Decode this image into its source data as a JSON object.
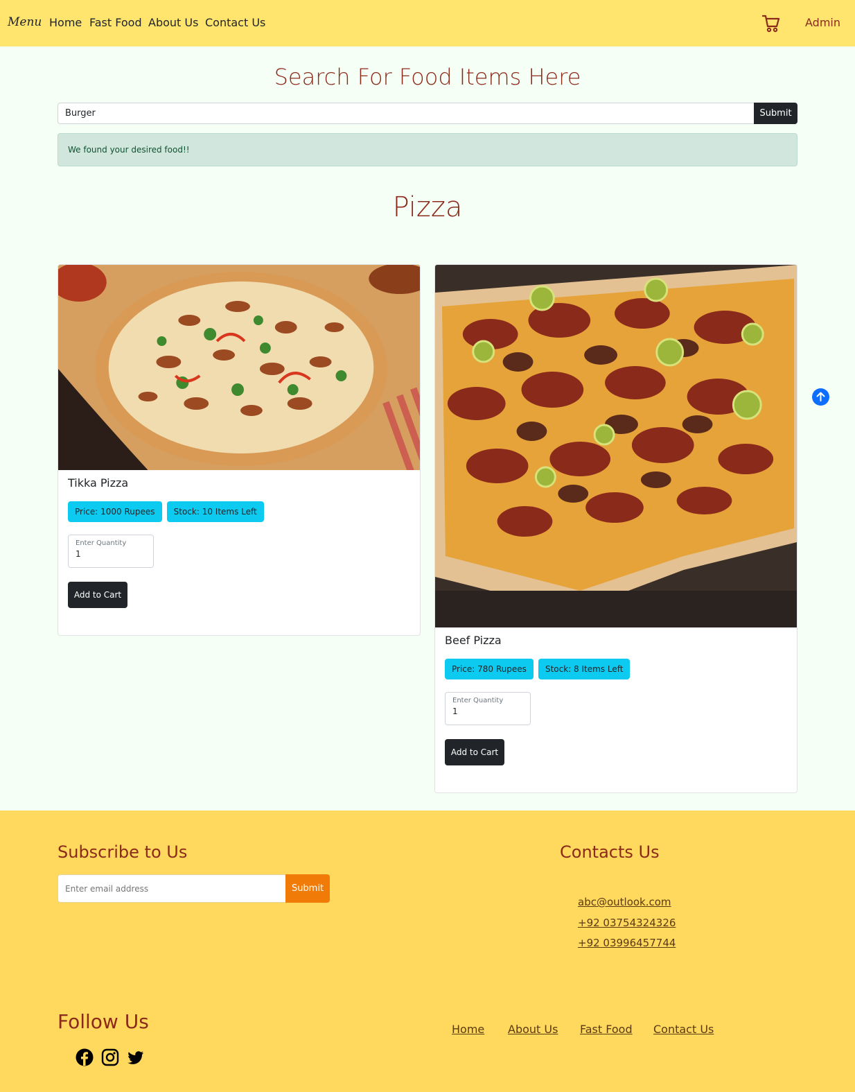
{
  "nav": {
    "brand": "Menu",
    "links": [
      "Home",
      "Fast Food",
      "About Us",
      "Contact Us"
    ],
    "cart_icon": "cart-icon",
    "admin": "Admin"
  },
  "search": {
    "title": "Search For Food Items Here",
    "value": "Burger",
    "submit": "Submit"
  },
  "alert": "We found your desired food!!",
  "category": "Pizza",
  "items": [
    {
      "name": "Tikka Pizza",
      "price": "Price: 1000 Rupees",
      "stock": "Stock: 10 Items Left",
      "qty_label": "Enter Quantity",
      "qty_value": "1",
      "button": "Add to Cart"
    },
    {
      "name": "Beef Pizza",
      "price": "Price: 780 Rupees",
      "stock": "Stock: 8 Items Left",
      "qty_label": "Enter Quantity",
      "qty_value": "1",
      "button": "Add to Cart"
    }
  ],
  "scroll_top_icon": "arrow-up-icon",
  "footer": {
    "subscribe_title": "Subscribe to Us",
    "email_placeholder": "Enter email address",
    "submit": "Submit",
    "contacts_title": "Contacts Us",
    "contacts": [
      "abc@outlook.com",
      "+92 03754324326",
      "+92 03996457744"
    ],
    "follow_title": "Follow Us",
    "social_icons": [
      "facebook-icon",
      "instagram-icon",
      "twitter-icon"
    ],
    "links": [
      "Home",
      "About Us",
      "Fast Food",
      "Contact Us"
    ]
  },
  "colors": {
    "navbar": "#ffe56e",
    "footer": "#ffd85e",
    "accent": "#8b2a1a",
    "badge": "#0dcaf0",
    "dark": "#212529",
    "orange": "#f07b06"
  }
}
